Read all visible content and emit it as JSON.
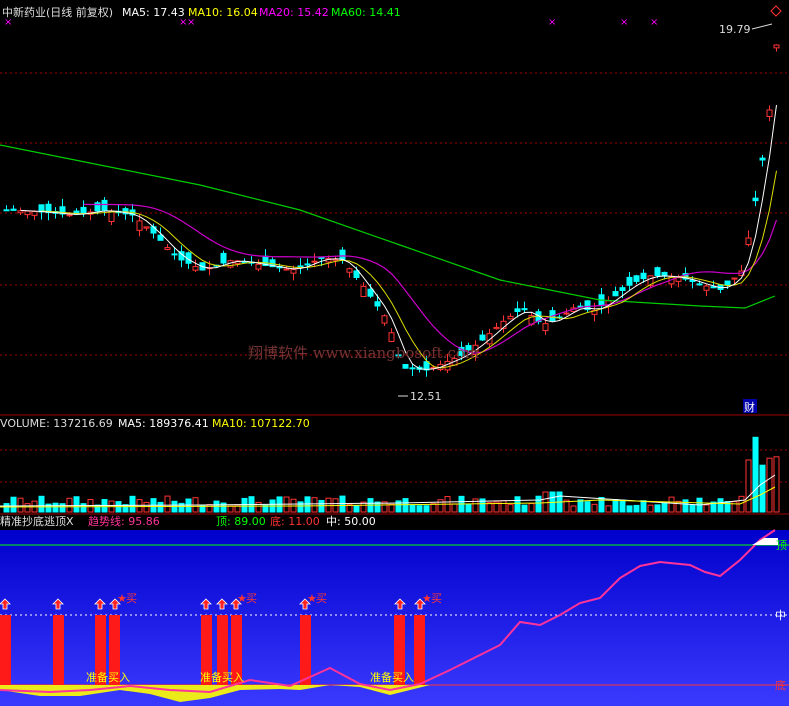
{
  "stock": {
    "title": "中新药业(日线 前复权)",
    "ma5_label": "MA5: 17.43",
    "ma10_label": "MA10: 16.04",
    "ma20_label": "MA20: 15.42",
    "ma60_label": "MA60: 14.41",
    "high_label": "19.79",
    "low_label": "12.51",
    "watermark": "翔博软件 www.xiangbosoft.com",
    "cai_label": "财"
  },
  "volume": {
    "vol_label": "VOLUME: 137216.69",
    "ma5_label": "MA5: 189376.41",
    "ma10_label": "MA10: 107122.70"
  },
  "indicator": {
    "name": "精准抄底逃顶X",
    "trend_label": "趋势线: 95.86",
    "top_label": "顶: 89.00",
    "bottom_label": "底: 11.00",
    "mid_label": "中: 50.00",
    "right_top": "顶",
    "right_mid": "中",
    "right_bottom": "底",
    "buy_label": "买",
    "prepare_label": "准备买入"
  },
  "colors": {
    "ma5": "#ffffff",
    "ma10": "#ffff00",
    "ma20": "#ff00ff",
    "ma60": "#00ff00",
    "up": "#ff3333",
    "down": "#00ffff",
    "trend": "#ff3399",
    "indicator_bg": "#1a1aaa"
  },
  "chart_data": [
    {
      "type": "candlestick",
      "title": "中新药业(日线 前复权)",
      "series": [
        {
          "name": "MA5",
          "values": [
            17.43
          ]
        },
        {
          "name": "MA10",
          "values": [
            16.04
          ]
        },
        {
          "name": "MA20",
          "values": [
            15.42
          ]
        },
        {
          "name": "MA60",
          "values": [
            14.41
          ]
        }
      ],
      "annotations": [
        "19.79",
        "12.51"
      ]
    },
    {
      "type": "bar",
      "title": "VOLUME",
      "series": [
        {
          "name": "VOLUME",
          "values": [
            137216.69
          ]
        },
        {
          "name": "MA5",
          "values": [
            189376.41
          ]
        },
        {
          "name": "MA10",
          "values": [
            107122.7
          ]
        }
      ]
    },
    {
      "type": "line",
      "title": "精准抄底逃顶X",
      "series": [
        {
          "name": "趋势线",
          "values": [
            95.86
          ]
        },
        {
          "name": "顶",
          "values": [
            89.0
          ]
        },
        {
          "name": "底",
          "values": [
            11.0
          ]
        },
        {
          "name": "中",
          "values": [
            50.0
          ]
        }
      ]
    }
  ]
}
